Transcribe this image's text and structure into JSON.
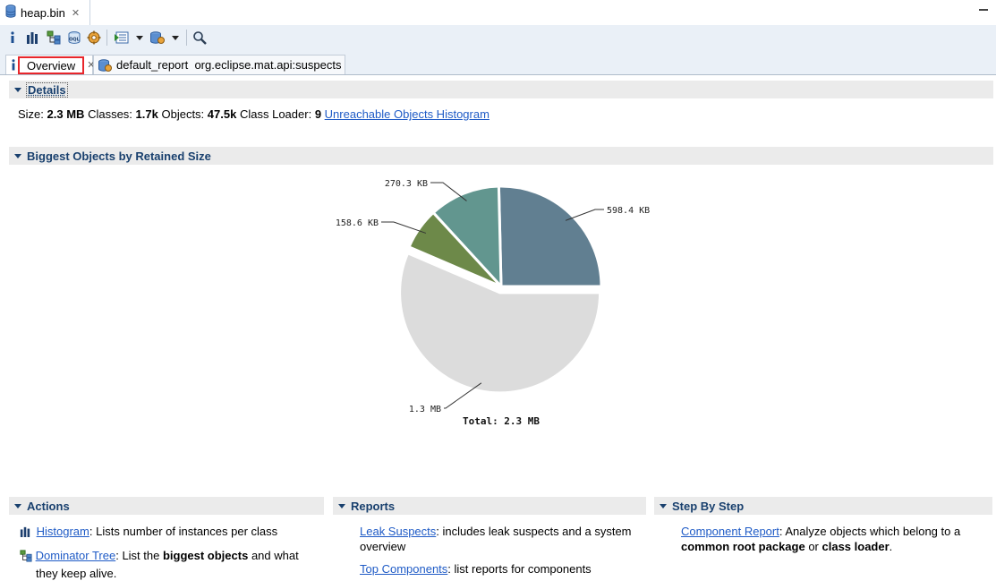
{
  "editor": {
    "tab_title": "heap.bin",
    "close_glyph": "✕"
  },
  "toolbar": {
    "icons": [
      "info-icon",
      "histogram-icon",
      "dominator-tree-icon",
      "oql-icon",
      "heap-dump-overview-icon",
      "run-report-icon",
      "query-browser-icon",
      "search-icon"
    ]
  },
  "subtabs": [
    {
      "label": "Overview",
      "icon": "info-icon",
      "close": "✕"
    },
    {
      "label": "default_report  org.eclipse.mat.api:suspects",
      "icon": "report-icon"
    }
  ],
  "details": {
    "title": "Details",
    "size_label": "Size:",
    "size_value": "2.3 MB",
    "classes_label": "Classes:",
    "classes_value": "1.7k",
    "objects_label": "Objects:",
    "objects_value": "47.5k",
    "loader_label": "Class Loader:",
    "loader_value": "9",
    "link": "Unreachable Objects Histogram"
  },
  "biggest": {
    "title": "Biggest Objects by Retained Size"
  },
  "chart_data": {
    "type": "pie",
    "unit": "KB",
    "slices": [
      {
        "label": "598.4 KB",
        "value": 598.4,
        "color": "#617f91"
      },
      {
        "label": "270.3 KB",
        "value": 270.3,
        "color": "#62968f"
      },
      {
        "label": "158.6 KB",
        "value": 158.6,
        "color": "#6d8949"
      },
      {
        "label": "1.3 MB",
        "value": 1331.2,
        "color": "#dcdcdc"
      }
    ],
    "total_label": "Total: 2.3 MB"
  },
  "actions": {
    "title": "Actions",
    "histogram_link": "Histogram",
    "histogram_text": ": Lists number of instances per class",
    "dominator_link": "Dominator Tree",
    "dominator_text1": ": List the ",
    "dominator_bold": "biggest objects",
    "dominator_text2": " and what",
    "dominator_text3": "they keep alive."
  },
  "reports": {
    "title": "Reports",
    "leak_link": "Leak Suspects",
    "leak_text": ": includes leak suspects and a system",
    "leak_text2": "overview",
    "top_link": "Top Components",
    "top_text": ": list reports for components"
  },
  "stepbystep": {
    "title": "Step By Step",
    "comp_link": "Component Report",
    "comp_text": ": Analyze objects which belong to a",
    "comp_bold1": "common root package",
    "comp_or": " or ",
    "comp_bold2": "class loader",
    "comp_end": "."
  },
  "colors": {
    "accent": "#19406e",
    "link": "#1f5bc6",
    "highlight": "#e8262b"
  }
}
